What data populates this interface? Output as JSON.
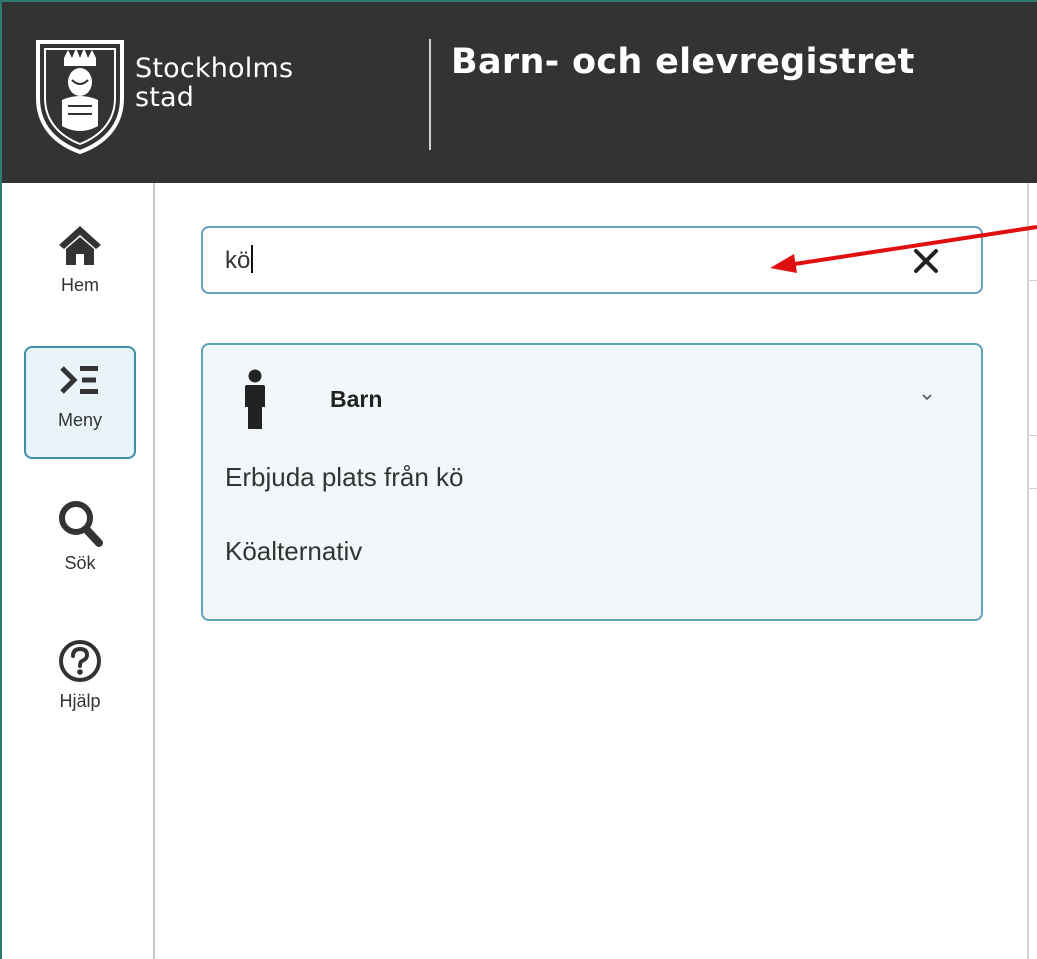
{
  "header": {
    "logo_lines": [
      "Stockholms",
      "stad"
    ],
    "app_title": "Barn- och elevregistret"
  },
  "sidebar": {
    "items": [
      {
        "label": "Hem",
        "icon": "home-icon"
      },
      {
        "label": "Meny",
        "icon": "menu-sum-icon",
        "active": true
      },
      {
        "label": "Sök",
        "icon": "search-icon"
      },
      {
        "label": "Hjälp",
        "icon": "help-icon"
      }
    ]
  },
  "search": {
    "value": "kö",
    "clear_icon": "close-icon"
  },
  "results": {
    "group_label": "Barn",
    "group_icon": "person-icon",
    "items": [
      "Erbjuda plats från kö",
      "Köalternativ"
    ]
  },
  "colors": {
    "header_bg": "#333333",
    "accent": "#5fa3bb",
    "panel_bg": "#f2f8fa",
    "annotation_arrow": "#e01010"
  }
}
